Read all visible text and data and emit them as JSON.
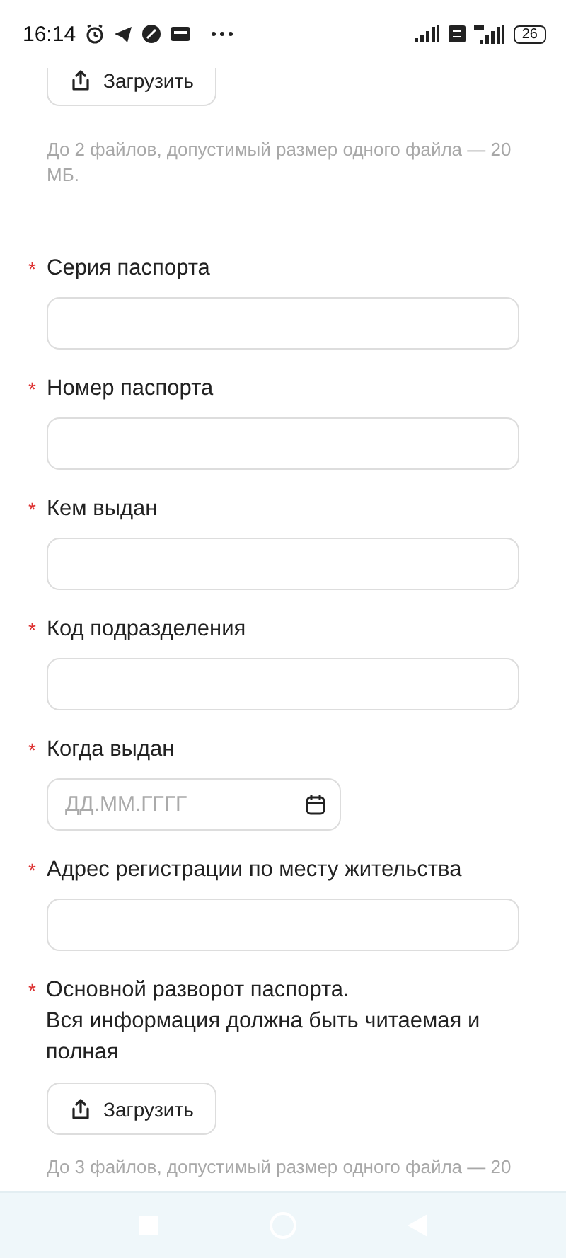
{
  "status_bar": {
    "time": "16:14",
    "battery": "26"
  },
  "top_upload": {
    "button": "Загрузить",
    "hint": "До 2 файлов, допустимый размер одного файла — 20 МБ."
  },
  "fields": [
    {
      "kind": "text",
      "label": "Серия паспорта",
      "required_mark": "*"
    },
    {
      "kind": "text",
      "label": "Номер паспорта",
      "required_mark": "*"
    },
    {
      "kind": "text",
      "label": "Кем выдан",
      "required_mark": "*"
    },
    {
      "kind": "text",
      "label": "Код подразделения",
      "required_mark": "*"
    },
    {
      "kind": "date",
      "label": "Когда выдан",
      "required_mark": "*",
      "placeholder": "ДД.ММ.ГГГГ"
    },
    {
      "kind": "text",
      "label": "Адрес регистрации по месту жительства",
      "required_mark": "*"
    },
    {
      "kind": "upload",
      "label": "Основной разворот паспорта.\nВся информация должна быть читаемая и полная",
      "required_mark": "*",
      "button": "Загрузить",
      "hint": "До 3 файлов, допустимый размер одного файла — 20"
    }
  ]
}
